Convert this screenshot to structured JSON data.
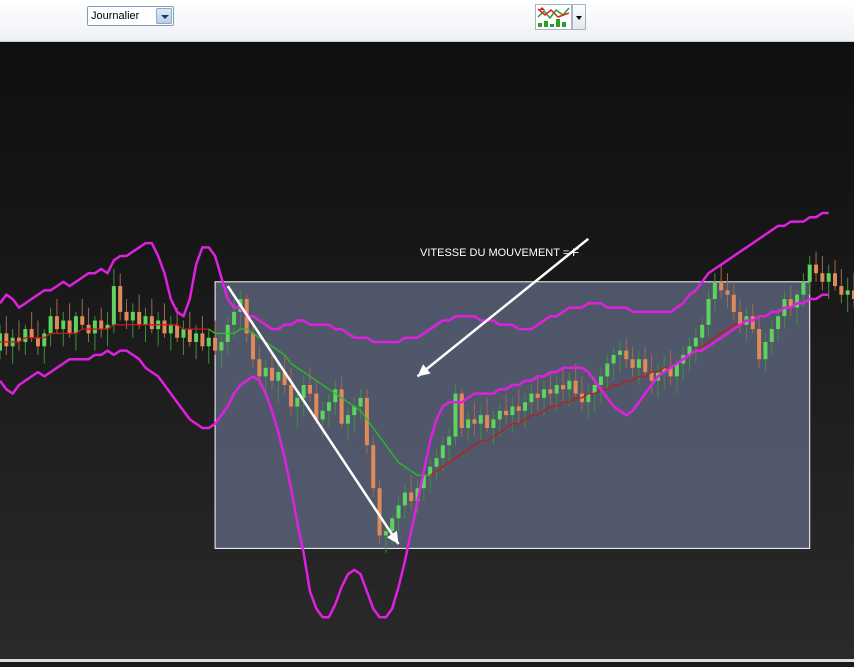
{
  "toolbar": {
    "period_select_value": "Journalier",
    "chart_type_icon": "candlestick-chart-icon"
  },
  "colors": {
    "background": "#1a1a1a",
    "bollinger_band": "#e020e0",
    "moving_average_up": "#22c322",
    "moving_average_down": "#c01a1a",
    "candle_up": "#5fd35f",
    "candle_down": "#e08a5a",
    "highlight_box": "#5a6178",
    "arrow": "#ffffff"
  },
  "annotation": {
    "text": "VITESSE DU MOUVEMENT = F"
  },
  "chart_data": {
    "type": "candlestick",
    "title": "",
    "xlabel": "",
    "ylabel": "",
    "grid": false,
    "ylim": [
      0,
      100
    ],
    "candles": [
      [
        48,
        54,
        46,
        52
      ],
      [
        52,
        56,
        47,
        49
      ],
      [
        49,
        53,
        45,
        51
      ],
      [
        51,
        55,
        48,
        50
      ],
      [
        50,
        54,
        47,
        53
      ],
      [
        53,
        57,
        50,
        51
      ],
      [
        51,
        55,
        47,
        49
      ],
      [
        49,
        53,
        45,
        52
      ],
      [
        52,
        58,
        49,
        56
      ],
      [
        56,
        60,
        52,
        53
      ],
      [
        53,
        57,
        49,
        55
      ],
      [
        55,
        59,
        51,
        52
      ],
      [
        52,
        57,
        48,
        56
      ],
      [
        56,
        60,
        53,
        54
      ],
      [
        54,
        58,
        50,
        52
      ],
      [
        52,
        56,
        48,
        55
      ],
      [
        55,
        58,
        51,
        53
      ],
      [
        53,
        57,
        49,
        54
      ],
      [
        54,
        67,
        52,
        63
      ],
      [
        63,
        66,
        55,
        57
      ],
      [
        57,
        60,
        53,
        55
      ],
      [
        55,
        59,
        51,
        57
      ],
      [
        57,
        61,
        53,
        54
      ],
      [
        54,
        58,
        50,
        56
      ],
      [
        56,
        60,
        52,
        53
      ],
      [
        53,
        57,
        49,
        55
      ],
      [
        55,
        59,
        51,
        52
      ],
      [
        52,
        56,
        48,
        54
      ],
      [
        54,
        58,
        50,
        51
      ],
      [
        51,
        55,
        47,
        53
      ],
      [
        53,
        57,
        49,
        50
      ],
      [
        50,
        54,
        46,
        52
      ],
      [
        52,
        56,
        48,
        49
      ],
      [
        49,
        53,
        45,
        51
      ],
      [
        51,
        55,
        47,
        48
      ],
      [
        48,
        52,
        44,
        50
      ],
      [
        50,
        56,
        47,
        54
      ],
      [
        54,
        60,
        51,
        57
      ],
      [
        57,
        62,
        53,
        60
      ],
      [
        60,
        61,
        50,
        52
      ],
      [
        52,
        55,
        44,
        46
      ],
      [
        46,
        49,
        40,
        42
      ],
      [
        42,
        46,
        37,
        44
      ],
      [
        44,
        48,
        39,
        41
      ],
      [
        41,
        45,
        36,
        43
      ],
      [
        43,
        47,
        38,
        40
      ],
      [
        40,
        44,
        33,
        35
      ],
      [
        35,
        39,
        30,
        37
      ],
      [
        37,
        42,
        33,
        40
      ],
      [
        40,
        44,
        36,
        38
      ],
      [
        38,
        41,
        31,
        32
      ],
      [
        32,
        36,
        28,
        34
      ],
      [
        34,
        38,
        30,
        36
      ],
      [
        36,
        41,
        33,
        39
      ],
      [
        39,
        42,
        30,
        31
      ],
      [
        31,
        35,
        27,
        33
      ],
      [
        33,
        37,
        29,
        35
      ],
      [
        35,
        39,
        32,
        37
      ],
      [
        37,
        39,
        24,
        26
      ],
      [
        26,
        28,
        14,
        16
      ],
      [
        16,
        18,
        3,
        5
      ],
      [
        5,
        8,
        1,
        6
      ],
      [
        6,
        10,
        3,
        9
      ],
      [
        9,
        14,
        6,
        12
      ],
      [
        12,
        17,
        9,
        15
      ],
      [
        15,
        19,
        11,
        13
      ],
      [
        13,
        18,
        10,
        16
      ],
      [
        16,
        21,
        13,
        19
      ],
      [
        19,
        23,
        15,
        21
      ],
      [
        21,
        25,
        18,
        23
      ],
      [
        23,
        28,
        20,
        26
      ],
      [
        26,
        30,
        22,
        28
      ],
      [
        28,
        40,
        26,
        38
      ],
      [
        38,
        39,
        28,
        30
      ],
      [
        30,
        34,
        27,
        32
      ],
      [
        32,
        36,
        28,
        31
      ],
      [
        31,
        35,
        27,
        33
      ],
      [
        33,
        37,
        29,
        30
      ],
      [
        30,
        34,
        26,
        32
      ],
      [
        32,
        36,
        28,
        34
      ],
      [
        34,
        38,
        31,
        33
      ],
      [
        33,
        37,
        29,
        35
      ],
      [
        35,
        39,
        31,
        34
      ],
      [
        34,
        38,
        30,
        36
      ],
      [
        36,
        40,
        33,
        38
      ],
      [
        38,
        42,
        34,
        37
      ],
      [
        37,
        41,
        33,
        39
      ],
      [
        39,
        43,
        35,
        38
      ],
      [
        38,
        42,
        34,
        40
      ],
      [
        40,
        44,
        36,
        39
      ],
      [
        39,
        43,
        35,
        41
      ],
      [
        41,
        45,
        37,
        38
      ],
      [
        38,
        42,
        34,
        36
      ],
      [
        36,
        40,
        32,
        38
      ],
      [
        38,
        42,
        34,
        40
      ],
      [
        40,
        44,
        36,
        42
      ],
      [
        42,
        47,
        39,
        45
      ],
      [
        45,
        49,
        41,
        47
      ],
      [
        47,
        50,
        43,
        48
      ],
      [
        48,
        51,
        44,
        46
      ],
      [
        46,
        49,
        42,
        44
      ],
      [
        44,
        48,
        40,
        46
      ],
      [
        46,
        49,
        42,
        43
      ],
      [
        43,
        47,
        38,
        41
      ],
      [
        41,
        45,
        37,
        43
      ],
      [
        43,
        47,
        39,
        44
      ],
      [
        44,
        48,
        40,
        42
      ],
      [
        42,
        46,
        38,
        45
      ],
      [
        45,
        49,
        41,
        47
      ],
      [
        47,
        51,
        43,
        49
      ],
      [
        49,
        53,
        45,
        51
      ],
      [
        51,
        56,
        48,
        54
      ],
      [
        54,
        62,
        51,
        60
      ],
      [
        60,
        66,
        57,
        64
      ],
      [
        64,
        68,
        60,
        62
      ],
      [
        62,
        66,
        58,
        61
      ],
      [
        61,
        64,
        55,
        57
      ],
      [
        57,
        60,
        52,
        54
      ],
      [
        54,
        58,
        50,
        56
      ],
      [
        56,
        59,
        52,
        53
      ],
      [
        53,
        56,
        44,
        46
      ],
      [
        46,
        52,
        43,
        50
      ],
      [
        50,
        55,
        47,
        53
      ],
      [
        53,
        58,
        50,
        56
      ],
      [
        56,
        62,
        53,
        60
      ],
      [
        60,
        63,
        56,
        58
      ],
      [
        58,
        62,
        54,
        61
      ],
      [
        61,
        66,
        58,
        64
      ],
      [
        64,
        70,
        61,
        68
      ],
      [
        68,
        71,
        64,
        66
      ],
      [
        66,
        70,
        62,
        64
      ],
      [
        64,
        68,
        60,
        66
      ],
      [
        66,
        69,
        62,
        63
      ],
      [
        63,
        67,
        59,
        61
      ],
      [
        61,
        65,
        57,
        62
      ],
      [
        62,
        66,
        58,
        60
      ]
    ],
    "moving_average": [
      50,
      50,
      50,
      50,
      51,
      51,
      51,
      51,
      52,
      52,
      52,
      52,
      52,
      53,
      53,
      53,
      53,
      53,
      54,
      54,
      54,
      54,
      54,
      54,
      54,
      54,
      54,
      54,
      54,
      53,
      53,
      53,
      53,
      53,
      52,
      52,
      52,
      52,
      53,
      53,
      52,
      51,
      50,
      49,
      48,
      47,
      45,
      44,
      43,
      42,
      41,
      40,
      39,
      38,
      37,
      36,
      35,
      34,
      32,
      30,
      28,
      26,
      24,
      22,
      21,
      20,
      19,
      19,
      19,
      20,
      21,
      22,
      23,
      24,
      25,
      26,
      27,
      27,
      28,
      29,
      30,
      31,
      31,
      32,
      33,
      33,
      34,
      35,
      35,
      36,
      36,
      37,
      37,
      38,
      38,
      39,
      39,
      40,
      40,
      41,
      41,
      42,
      42,
      43,
      43,
      44,
      44,
      45,
      46,
      47,
      48,
      49,
      50,
      51,
      52,
      53,
      54,
      54,
      55,
      55,
      56,
      56,
      57,
      57,
      58,
      58,
      59,
      59,
      60,
      60,
      61,
      61
    ],
    "bollinger_upper": [
      59,
      61,
      60,
      58,
      59,
      60,
      61,
      62,
      62,
      63,
      64,
      63,
      64,
      65,
      66,
      66,
      67,
      66,
      69,
      70,
      70,
      71,
      72,
      73,
      73,
      70,
      66,
      60,
      57,
      56,
      60,
      68,
      72,
      72,
      70,
      65,
      60,
      58,
      58,
      56,
      56,
      55,
      54,
      53,
      53,
      54,
      54,
      55,
      55,
      54,
      54,
      54,
      54,
      53,
      53,
      52,
      51,
      51,
      51,
      50,
      50,
      50,
      50,
      50,
      51,
      51,
      51,
      52,
      53,
      54,
      55,
      55,
      56,
      56,
      56,
      56,
      55,
      55,
      55,
      54,
      54,
      54,
      53,
      53,
      53,
      54,
      55,
      56,
      56,
      57,
      58,
      58,
      58,
      59,
      59,
      59,
      58,
      58,
      58,
      58,
      57,
      57,
      57,
      57,
      57,
      57,
      57,
      58,
      59,
      61,
      62,
      64,
      66,
      67,
      68,
      69,
      70,
      71,
      72,
      73,
      74,
      75,
      76,
      77,
      77,
      78,
      78,
      78,
      79,
      79,
      80,
      80
    ],
    "bollinger_lower": [
      41,
      39,
      38,
      40,
      41,
      42,
      43,
      42,
      43,
      44,
      45,
      46,
      46,
      46,
      46,
      47,
      47,
      48,
      47,
      48,
      48,
      47,
      46,
      44,
      43,
      42,
      40,
      38,
      36,
      34,
      32,
      31,
      30,
      30,
      31,
      33,
      35,
      38,
      40,
      41,
      42,
      41,
      38,
      34,
      29,
      23,
      16,
      8,
      1,
      -8,
      -12,
      -14,
      -14,
      -11,
      -7,
      -4,
      -3,
      -4,
      -8,
      -12,
      -14,
      -14,
      -12,
      -7,
      -1,
      6,
      13,
      20,
      27,
      32,
      35,
      36,
      36,
      36,
      37,
      38,
      38,
      38,
      38,
      39,
      39,
      40,
      40,
      41,
      41,
      42,
      42,
      43,
      43,
      44,
      44,
      44,
      44,
      43,
      41,
      39,
      37,
      35,
      34,
      33,
      34,
      36,
      38,
      40,
      42,
      43,
      44,
      45,
      46,
      47,
      48,
      48,
      49,
      50,
      51,
      52,
      53,
      54,
      55,
      55,
      56,
      56,
      57,
      57,
      58,
      58,
      59,
      59,
      60,
      60,
      61,
      61
    ],
    "highlight_region": {
      "x_start": 34,
      "x_end": 128,
      "y_min": 2,
      "y_max": 64
    },
    "arrows": [
      {
        "from": [
          36,
          63
        ],
        "to": [
          63,
          3
        ]
      },
      {
        "from": [
          93,
          74
        ],
        "to": [
          66,
          42
        ]
      }
    ]
  }
}
